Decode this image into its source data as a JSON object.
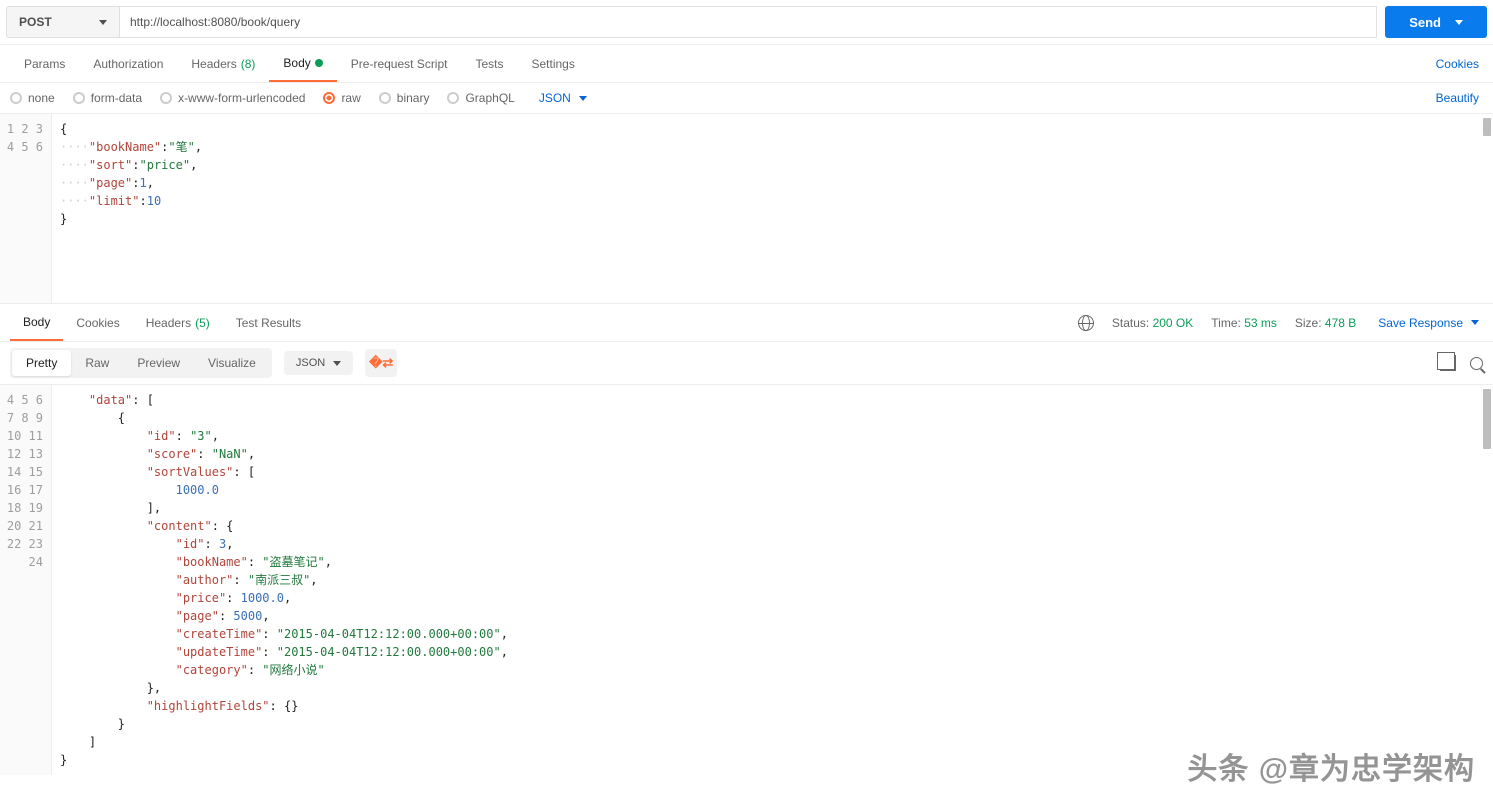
{
  "request": {
    "method": "POST",
    "url": "http://localhost:8080/book/query",
    "send_label": "Send"
  },
  "tabs": {
    "params": "Params",
    "authorization": "Authorization",
    "headers": "Headers",
    "headers_count": "(8)",
    "body": "Body",
    "prerequest": "Pre-request Script",
    "tests": "Tests",
    "settings": "Settings",
    "cookies_link": "Cookies"
  },
  "body_types": {
    "none": "none",
    "formdata": "form-data",
    "urlencoded": "x-www-form-urlencoded",
    "raw": "raw",
    "binary": "binary",
    "graphql": "GraphQL",
    "format": "JSON",
    "beautify": "Beautify"
  },
  "request_body": {
    "lines": [
      "1",
      "2",
      "3",
      "4",
      "5",
      "6"
    ],
    "l1": "{",
    "l2_k": "\"bookName\"",
    "l2_v": "\"笔\"",
    "l3_k": "\"sort\"",
    "l3_v": "\"price\"",
    "l4_k": "\"page\"",
    "l4_v": "1",
    "l5_k": "\"limit\"",
    "l5_v": "10",
    "l6": "}",
    "dots": "····"
  },
  "resp_tabs": {
    "body": "Body",
    "cookies": "Cookies",
    "headers": "Headers",
    "headers_count": "(5)",
    "testresults": "Test Results"
  },
  "resp_meta": {
    "status_label": "Status:",
    "status_value": "200 OK",
    "time_label": "Time:",
    "time_value": "53 ms",
    "size_label": "Size:",
    "size_value": "478 B",
    "save": "Save Response"
  },
  "resp_toolbar": {
    "pretty": "Pretty",
    "raw": "Raw",
    "preview": "Preview",
    "visualize": "Visualize",
    "format": "JSON"
  },
  "response_body": {
    "line_start": 4,
    "lines": [
      "4",
      "5",
      "6",
      "7",
      "8",
      "9",
      "10",
      "11",
      "12",
      "13",
      "14",
      "15",
      "16",
      "17",
      "18",
      "19",
      "20",
      "21",
      "22",
      "23",
      "24"
    ],
    "data_k": "\"data\"",
    "id_k": "\"id\"",
    "id_v": "\"3\"",
    "score_k": "\"score\"",
    "score_v": "\"NaN\"",
    "sortValues_k": "\"sortValues\"",
    "sv_num": "1000.0",
    "content_k": "\"content\"",
    "c_id_k": "\"id\"",
    "c_id_v": "3",
    "c_book_k": "\"bookName\"",
    "c_book_v": "\"盗墓笔记\"",
    "c_auth_k": "\"author\"",
    "c_auth_v": "\"南派三叔\"",
    "c_price_k": "\"price\"",
    "c_price_v": "1000.0",
    "c_page_k": "\"page\"",
    "c_page_v": "5000",
    "c_ct_k": "\"createTime\"",
    "c_ct_v": "\"2015-04-04T12:12:00.000+00:00\"",
    "c_ut_k": "\"updateTime\"",
    "c_ut_v": "\"2015-04-04T12:12:00.000+00:00\"",
    "c_cat_k": "\"category\"",
    "c_cat_v": "\"网络小说\"",
    "hf_k": "\"highlightFields\"",
    "close_brace": "}",
    "close_bracket": "]"
  },
  "watermark": "头条 @章为忠学架构"
}
